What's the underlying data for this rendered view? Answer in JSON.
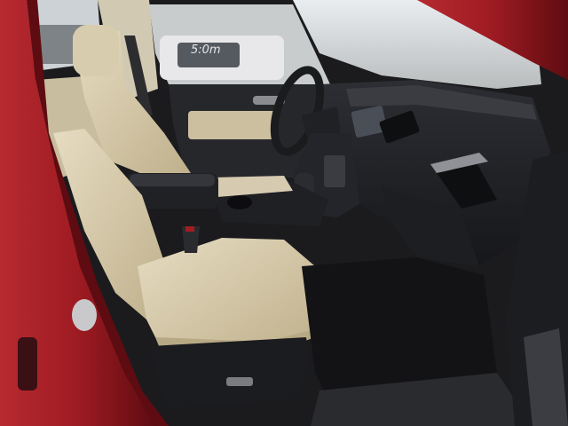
{
  "photo": {
    "window_sticker_text": "5:0m",
    "colors": {
      "body_paint": "#9e1b22",
      "body_paint_dark": "#5e0c11",
      "seat_leather": "#d9cdb0",
      "seat_shadow": "#b7a984",
      "dashboard": "#232428",
      "dash_highlight": "#3a3c42",
      "carpet": "#141416",
      "sky": "#d8dde2",
      "outside_ground": "#8d8c86"
    }
  }
}
